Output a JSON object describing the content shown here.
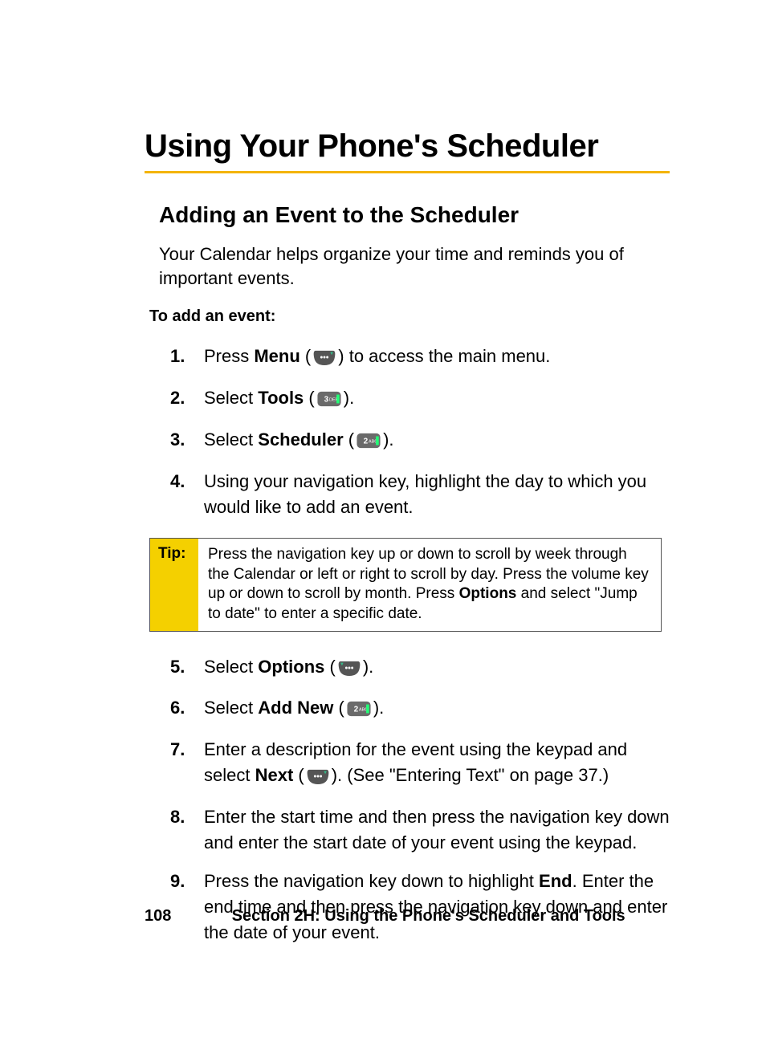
{
  "title": "Using Your Phone's Scheduler",
  "section_title": "Adding an Event to the Scheduler",
  "intro": "Your Calendar helps organize your time and reminds you of important events.",
  "lead_in": "To add an event:",
  "steps_a": {
    "1": {
      "num": "1.",
      "pre": "Press ",
      "bold": "Menu",
      "post": " (",
      "icon": "menu-key",
      "tail": ") to access the main menu."
    },
    "2": {
      "num": "2.",
      "pre": "Select ",
      "bold": "Tools",
      "post": " (",
      "icon": "3-key",
      "tail": ")."
    },
    "3": {
      "num": "3.",
      "pre": "Select ",
      "bold": "Scheduler",
      "post": " (",
      "icon": "2-key",
      "tail": ")."
    },
    "4": {
      "num": "4.",
      "text": "Using your navigation key, highlight the day to which you would like to add an event."
    }
  },
  "tip": {
    "label": "Tip:",
    "body_pre": "Press the navigation key up or down to scroll by week through the Calendar or left or right to scroll by day. Press the volume key up or down to scroll by month. Press ",
    "bold": "Options",
    "body_post": " and select \"Jump to date\" to enter a specific date."
  },
  "steps_b": {
    "5": {
      "num": "5.",
      "pre": "Select ",
      "bold": "Options",
      "post": " (",
      "icon": "options-key",
      "tail": ")."
    },
    "6": {
      "num": "6.",
      "pre": "Select ",
      "bold": "Add New",
      "post": " (",
      "icon": "2-key",
      "tail": ")."
    },
    "7": {
      "num": "7.",
      "pre": "Enter a description for the event using the keypad and select ",
      "bold": "Next",
      "post": " (",
      "icon": "menu-key",
      "tail": "). (See \"Entering Text\" on page 37.)"
    },
    "8": {
      "num": "8.",
      "text": "Enter the start time and then press the navigation key down and enter the start date of your event using the keypad."
    },
    "9": {
      "num": "9.",
      "pre": "Press the navigation key down to highlight ",
      "bold": "End",
      "tail": ". Enter the end time and then press the navigation key down and enter the date of your event."
    }
  },
  "footer": {
    "page_num": "108",
    "title": "Section 2H: Using the Phone's Scheduler and Tools"
  }
}
